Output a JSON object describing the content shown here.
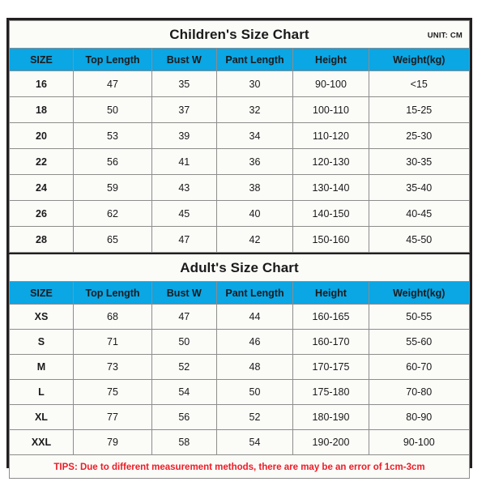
{
  "colors": {
    "header_blue": "#0ba6e4",
    "border_dark": "#231f20",
    "grid_gray": "#8d8d8d",
    "cell_bg": "#fbfbf8",
    "tips_red": "#ee1c25",
    "text": "#1a1a1a"
  },
  "children": {
    "title": "Children's Size Chart",
    "unit": "UNIT: CM",
    "columns": [
      "SIZE",
      "Top Length",
      "Bust W",
      "Pant Length",
      "Height",
      "Weight(kg)"
    ],
    "rows": [
      [
        "16",
        "47",
        "35",
        "30",
        "90-100",
        "<15"
      ],
      [
        "18",
        "50",
        "37",
        "32",
        "100-110",
        "15-25"
      ],
      [
        "20",
        "53",
        "39",
        "34",
        "110-120",
        "25-30"
      ],
      [
        "22",
        "56",
        "41",
        "36",
        "120-130",
        "30-35"
      ],
      [
        "24",
        "59",
        "43",
        "38",
        "130-140",
        "35-40"
      ],
      [
        "26",
        "62",
        "45",
        "40",
        "140-150",
        "40-45"
      ],
      [
        "28",
        "65",
        "47",
        "42",
        "150-160",
        "45-50"
      ]
    ]
  },
  "adult": {
    "title": "Adult's Size Chart",
    "columns": [
      "SIZE",
      "Top Length",
      "Bust W",
      "Pant Length",
      "Height",
      "Weight(kg)"
    ],
    "rows": [
      [
        "XS",
        "68",
        "47",
        "44",
        "160-165",
        "50-55"
      ],
      [
        "S",
        "71",
        "50",
        "46",
        "160-170",
        "55-60"
      ],
      [
        "M",
        "73",
        "52",
        "48",
        "170-175",
        "60-70"
      ],
      [
        "L",
        "75",
        "54",
        "50",
        "175-180",
        "70-80"
      ],
      [
        "XL",
        "77",
        "56",
        "52",
        "180-190",
        "80-90"
      ],
      [
        "XXL",
        "79",
        "58",
        "54",
        "190-200",
        "90-100"
      ]
    ]
  },
  "footer": {
    "tips": "TIPS: Due to different measurement methods, there are may be an error of 1cm-3cm"
  }
}
